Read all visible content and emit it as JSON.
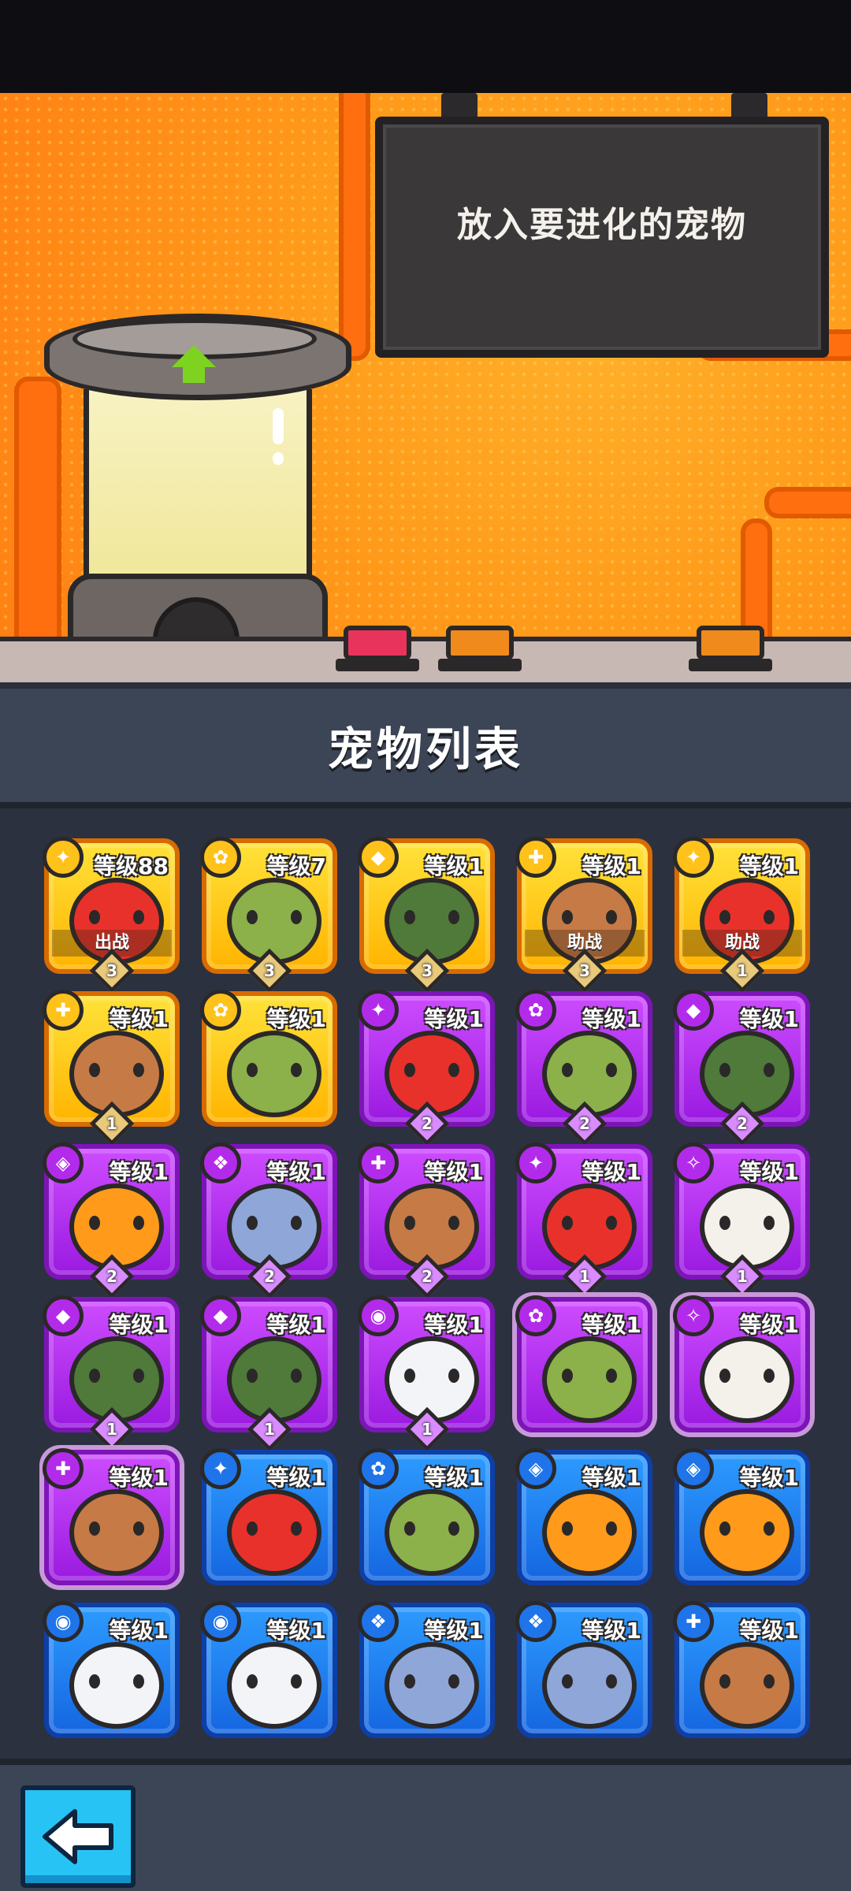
{
  "evolve_board": {
    "prompt": "放入要进化的宠物"
  },
  "pet_list": {
    "title": "宠物列表",
    "pets": [
      {
        "rarity": "gold",
        "icon": "crab",
        "level": "等级88",
        "tag": "出战",
        "stars": "3",
        "color": "#e8312a"
      },
      {
        "rarity": "gold",
        "icon": "frog",
        "level": "等级7",
        "tag": "",
        "stars": "3",
        "color": "#8cb04a"
      },
      {
        "rarity": "gold",
        "icon": "turtle",
        "level": "等级1",
        "tag": "",
        "stars": "3",
        "color": "#4f7a3a"
      },
      {
        "rarity": "gold",
        "icon": "dog",
        "level": "等级1",
        "tag": "助战",
        "stars": "3",
        "color": "#c67a45"
      },
      {
        "rarity": "gold",
        "icon": "crab",
        "level": "等级1",
        "tag": "助战",
        "stars": "1",
        "color": "#e8312a"
      },
      {
        "rarity": "gold",
        "icon": "dog",
        "level": "等级1",
        "tag": "",
        "stars": "1",
        "color": "#c67a45"
      },
      {
        "rarity": "gold",
        "icon": "frog",
        "level": "等级1",
        "tag": "",
        "stars": "",
        "color": "#8cb04a"
      },
      {
        "rarity": "purple",
        "icon": "crab",
        "level": "等级1",
        "tag": "",
        "stars": "2",
        "color": "#e8312a"
      },
      {
        "rarity": "purple",
        "icon": "frog",
        "level": "等级1",
        "tag": "",
        "stars": "2",
        "color": "#8cb04a"
      },
      {
        "rarity": "purple",
        "icon": "turtle",
        "level": "等级1",
        "tag": "",
        "stars": "2",
        "color": "#4f7a3a"
      },
      {
        "rarity": "purple",
        "icon": "fish",
        "level": "等级1",
        "tag": "",
        "stars": "2",
        "color": "#ff9a1a"
      },
      {
        "rarity": "purple",
        "icon": "cat",
        "level": "等级1",
        "tag": "",
        "stars": "2",
        "color": "#8fa6d8"
      },
      {
        "rarity": "purple",
        "icon": "dog",
        "level": "等级1",
        "tag": "",
        "stars": "2",
        "color": "#c67a45"
      },
      {
        "rarity": "purple",
        "icon": "crab",
        "level": "等级1",
        "tag": "",
        "stars": "1",
        "color": "#e8312a"
      },
      {
        "rarity": "purple",
        "icon": "eagle",
        "level": "等级1",
        "tag": "",
        "stars": "1",
        "color": "#f4f1ea"
      },
      {
        "rarity": "purple",
        "icon": "turtle",
        "level": "等级1",
        "tag": "",
        "stars": "1",
        "color": "#4f7a3a"
      },
      {
        "rarity": "purple",
        "icon": "turtle",
        "level": "等级1",
        "tag": "",
        "stars": "1",
        "color": "#4f7a3a"
      },
      {
        "rarity": "purple",
        "icon": "robot",
        "level": "等级1",
        "tag": "",
        "stars": "1",
        "color": "#f2f4f7"
      },
      {
        "rarity": "purple",
        "icon": "frog",
        "level": "等级1",
        "tag": "",
        "stars": "",
        "color": "#8cb04a"
      },
      {
        "rarity": "purple",
        "icon": "eagle",
        "level": "等级1",
        "tag": "",
        "stars": "",
        "color": "#f4f1ea"
      },
      {
        "rarity": "purple",
        "icon": "dog",
        "level": "等级1",
        "tag": "",
        "stars": "",
        "color": "#c67a45"
      },
      {
        "rarity": "blue",
        "icon": "crab",
        "level": "等级1",
        "tag": "",
        "stars": "",
        "color": "#e8312a"
      },
      {
        "rarity": "blue",
        "icon": "frog",
        "level": "等级1",
        "tag": "",
        "stars": "",
        "color": "#8cb04a"
      },
      {
        "rarity": "blue",
        "icon": "fish",
        "level": "等级1",
        "tag": "",
        "stars": "",
        "color": "#ff9a1a"
      },
      {
        "rarity": "blue",
        "icon": "fish",
        "level": "等级1",
        "tag": "",
        "stars": "",
        "color": "#ff9a1a"
      },
      {
        "rarity": "blue",
        "icon": "robot",
        "level": "等级1",
        "tag": "",
        "stars": "",
        "color": "#f2f4f7"
      },
      {
        "rarity": "blue",
        "icon": "robot",
        "level": "等级1",
        "tag": "",
        "stars": "",
        "color": "#f2f4f7"
      },
      {
        "rarity": "blue",
        "icon": "cat",
        "level": "等级1",
        "tag": "",
        "stars": "",
        "color": "#8fa6d8"
      },
      {
        "rarity": "blue",
        "icon": "cat",
        "level": "等级1",
        "tag": "",
        "stars": "",
        "color": "#8fa6d8"
      },
      {
        "rarity": "blue",
        "icon": "dog",
        "level": "等级1",
        "tag": "",
        "stars": "",
        "color": "#c67a45"
      }
    ]
  },
  "nav": {
    "back_icon": "back-arrow-icon"
  }
}
